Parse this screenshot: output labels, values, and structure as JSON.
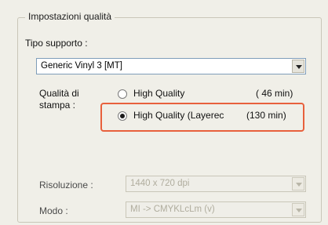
{
  "group": {
    "title": "Impostazioni qualità"
  },
  "media": {
    "label": "Tipo supporto :",
    "selected": "Generic Vinyl 3 [MT]"
  },
  "quality": {
    "label_line1": "Qualità di",
    "label_line2": "stampa :",
    "options": [
      {
        "label": "High Quality",
        "time": "( 46 min)",
        "checked": false
      },
      {
        "label": "High Quality (Layerec",
        "time": "(130 min)",
        "checked": true
      }
    ]
  },
  "resolution": {
    "label": "Risoluzione :",
    "selected": "1440 x 720 dpi"
  },
  "mode": {
    "label": "Modo :",
    "selected": "MI -> CMYKLcLm (v)"
  },
  "colors": {
    "highlight": "#e8603c",
    "combo_border": "#7f9db9"
  }
}
